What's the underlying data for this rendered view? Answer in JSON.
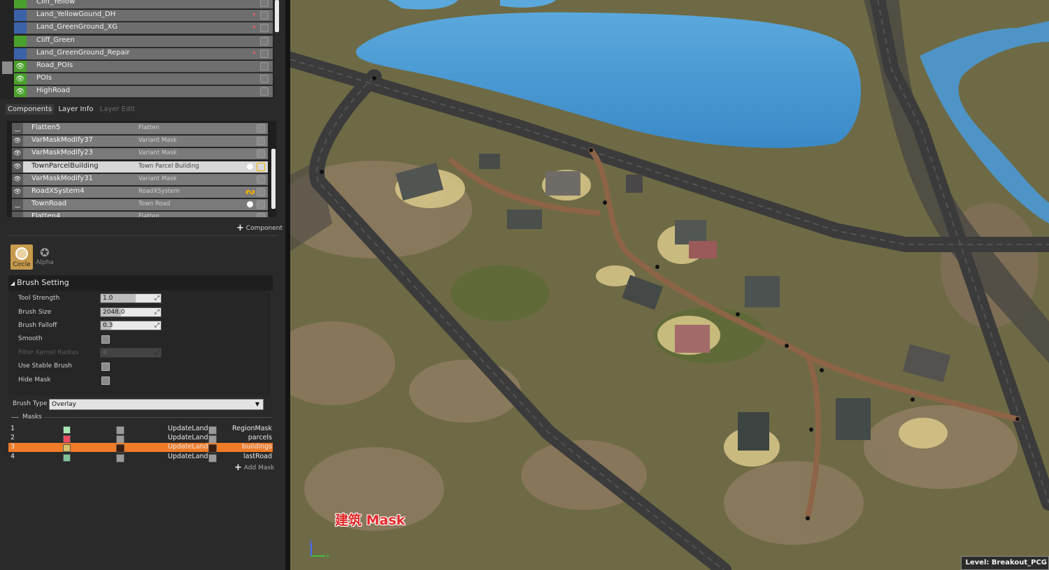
{
  "layers": [
    {
      "name": "Cliff_Yellow",
      "color": "#4aa02c",
      "visible": false,
      "dot": false
    },
    {
      "name": "Land_YellowGound_DH",
      "color": "#3c62a8",
      "visible": false,
      "dot": true
    },
    {
      "name": "Land_GreenGround_XG",
      "color": "#3c62a8",
      "visible": false,
      "dot": true
    },
    {
      "name": "Cliff_Green",
      "color": "#4aa02c",
      "visible": false,
      "dot": false
    },
    {
      "name": "Land_GreenGround_Repair",
      "color": "#3c62a8",
      "visible": false,
      "dot": true
    },
    {
      "name": "Road_POIs",
      "color": "#4aa02c",
      "visible": true,
      "dot": false
    },
    {
      "name": "POIs",
      "color": "#4aa02c",
      "visible": true,
      "dot": false
    },
    {
      "name": "HighRoad",
      "color": "#4aa02c",
      "visible": true,
      "dot": false
    }
  ],
  "tabs": {
    "components": "Components",
    "layer_info": "Layer Info",
    "layer_edit": "Layer Edit"
  },
  "components": [
    {
      "name": "Flatten5",
      "type": "Flatten",
      "visible": false,
      "marker": ""
    },
    {
      "name": "VarMaskModify37",
      "type": "Variant Mask",
      "visible": true,
      "marker": ""
    },
    {
      "name": "VarMaskModify23",
      "type": "Variant Mask",
      "visible": true,
      "marker": ""
    },
    {
      "name": "TownParcelBuilding",
      "type": "Town Parcel Building",
      "visible": true,
      "marker": "circle",
      "selected": true
    },
    {
      "name": "VarMaskModify31",
      "type": "Variant Mask",
      "visible": true,
      "marker": ""
    },
    {
      "name": "RoadXSystem4",
      "type": "RoadXSystem",
      "visible": true,
      "marker": "squiggle"
    },
    {
      "name": "TownRoad",
      "type": "Town Road",
      "visible": false,
      "marker": "circle"
    },
    {
      "name": "Flatten4",
      "type": "Flatten",
      "visible": false,
      "marker": ""
    }
  ],
  "add_component_label": "Component",
  "brush_shapes": {
    "circle": "Circle",
    "alpha": "Alpha"
  },
  "brush_setting": {
    "title": "Brush Setting",
    "tool_strength_label": "Tool Strength",
    "tool_strength": "1.0",
    "tool_strength_fill": 1.0,
    "brush_size_label": "Brush Size",
    "brush_size": "2048.0",
    "brush_size_fill": 0.57,
    "brush_falloff_label": "Brush Falloff",
    "brush_falloff": "0.3",
    "brush_falloff_fill": 0.3,
    "smooth_label": "Smooth",
    "filter_kernel_label": "Filter Kernel Radius",
    "filter_kernel": "4",
    "stable_brush_label": "Use Stable Brush",
    "hide_mask_label": "Hide Mask"
  },
  "brush_type": {
    "label": "Brush Type",
    "value": "Overlay"
  },
  "masks": {
    "title": "Masks",
    "rows": [
      {
        "index": "1",
        "color1": "#a8e8b0",
        "color2": "#9a9a9a",
        "update": "UpdateLand:",
        "color3": "#9a9a9a",
        "name": "RegionMask",
        "selected": false
      },
      {
        "index": "2",
        "color1": "#ec4a5e",
        "color2": "#9a9a9a",
        "update": "UpdateLand:",
        "color3": "#9a9a9a",
        "name": "parcels",
        "selected": false
      },
      {
        "index": "3",
        "color1": "#d8c26a",
        "color2": "#3a1e10",
        "update": "UpdateLand:",
        "color3": "#3a1e10",
        "name": "buildings",
        "selected": true
      },
      {
        "index": "4",
        "color1": "#7fc39a",
        "color2": "#9a9a9a",
        "update": "UpdateLand:",
        "color3": "#9a9a9a",
        "name": "lastRoad",
        "selected": false
      }
    ],
    "add_label": "Add Mask"
  },
  "viewport": {
    "overlay_label": "建筑 Mask",
    "level_label": "Level:",
    "level_name": "Breakout_PCG",
    "axis_z": "Z",
    "axis_y": "Y"
  }
}
